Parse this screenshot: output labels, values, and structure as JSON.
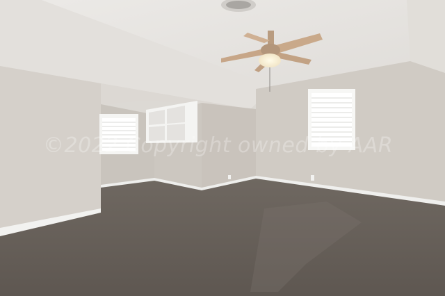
{
  "photo": {
    "subject": "empty-bonus-room",
    "watermark_text": "©2022 Copyright owned by AAR"
  },
  "colors": {
    "wall": "#d2cdc6",
    "wall_shadow": "#c4beb6",
    "ceiling": "#e8e6e3",
    "carpet": "#6e665f",
    "trim": "#f4f4f2",
    "fan_blade": "#c9a98a"
  }
}
